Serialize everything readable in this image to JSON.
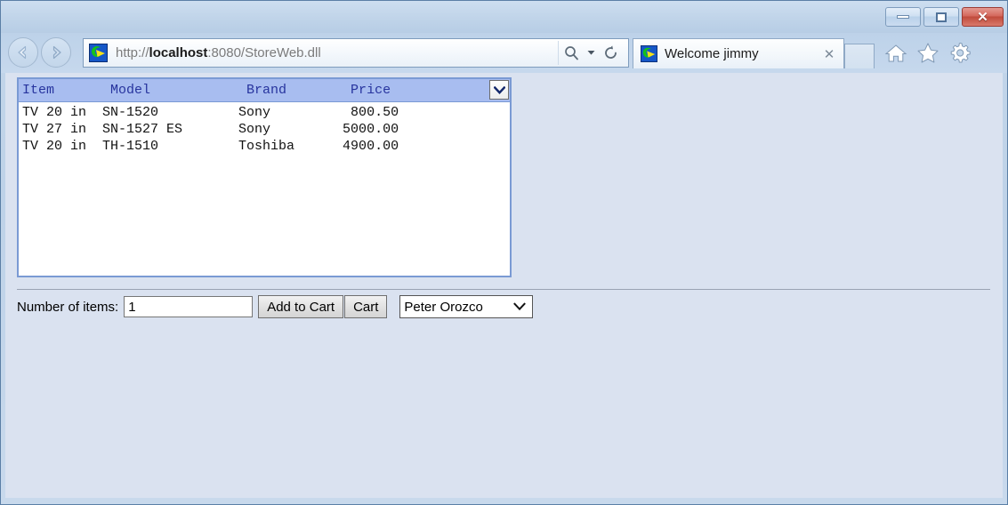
{
  "window": {
    "controls": {
      "minimize": "minimize-button",
      "maximize": "maximize-button",
      "close": "✕"
    }
  },
  "browser": {
    "back_icon": "back-arrow-icon",
    "forward_icon": "forward-arrow-icon",
    "address": {
      "url_prefix": "http://",
      "url_host": "localhost",
      "url_suffix": ":8080/StoreWeb.dll",
      "full_url": "http://localhost:8080/StoreWeb.dll",
      "favicon": "page-favicon",
      "search_icon": "search-icon",
      "search_dropdown_icon": "chevron-down-icon",
      "refresh_icon": "refresh-icon"
    },
    "tab": {
      "title": "Welcome jimmy",
      "favicon": "tab-favicon",
      "close_label": "✕"
    },
    "toolbar": {
      "home_icon": "home-icon",
      "favorites_icon": "star-icon",
      "settings_icon": "gear-icon"
    }
  },
  "page": {
    "product_list": {
      "header_line": "Item       Model            Brand        Price",
      "columns": [
        "Item",
        "Model",
        "Brand",
        "Price"
      ],
      "header_chevron": "chevron-down-icon",
      "rows": [
        {
          "line": "TV 20 in  SN-1520          Sony          800.50",
          "item": "TV 20 in",
          "model": "SN-1520",
          "brand": "Sony",
          "price": "800.50"
        },
        {
          "line": "TV 27 in  SN-1527 ES       Sony         5000.00",
          "item": "TV 27 in",
          "model": "SN-1527 ES",
          "brand": "Sony",
          "price": "5000.00"
        },
        {
          "line": "TV 20 in  TH-1510          Toshiba      4900.00",
          "item": "TV 20 in",
          "model": "TH-1510",
          "brand": "Toshiba",
          "price": "4900.00"
        }
      ],
      "body_text": "TV 20 in  SN-1520          Sony          800.50\nTV 27 in  SN-1527 ES       Sony         5000.00\nTV 20 in  TH-1510          Toshiba      4900.00"
    },
    "form": {
      "quantity_label": "Number of items:",
      "quantity_value": "1",
      "quantity_placeholder": "",
      "add_to_cart_label": "Add to Cart",
      "cart_label": "Cart",
      "user_selected": "Peter Orozco",
      "user_chevron": "chevron-down-icon"
    }
  },
  "colors": {
    "chrome": "#c3d6ea",
    "page_background": "#dae2f0",
    "list_border": "#7a9ad4",
    "list_header": "#a8bdf0",
    "header_text": "#27349e",
    "close_button": "#c04b3c"
  }
}
